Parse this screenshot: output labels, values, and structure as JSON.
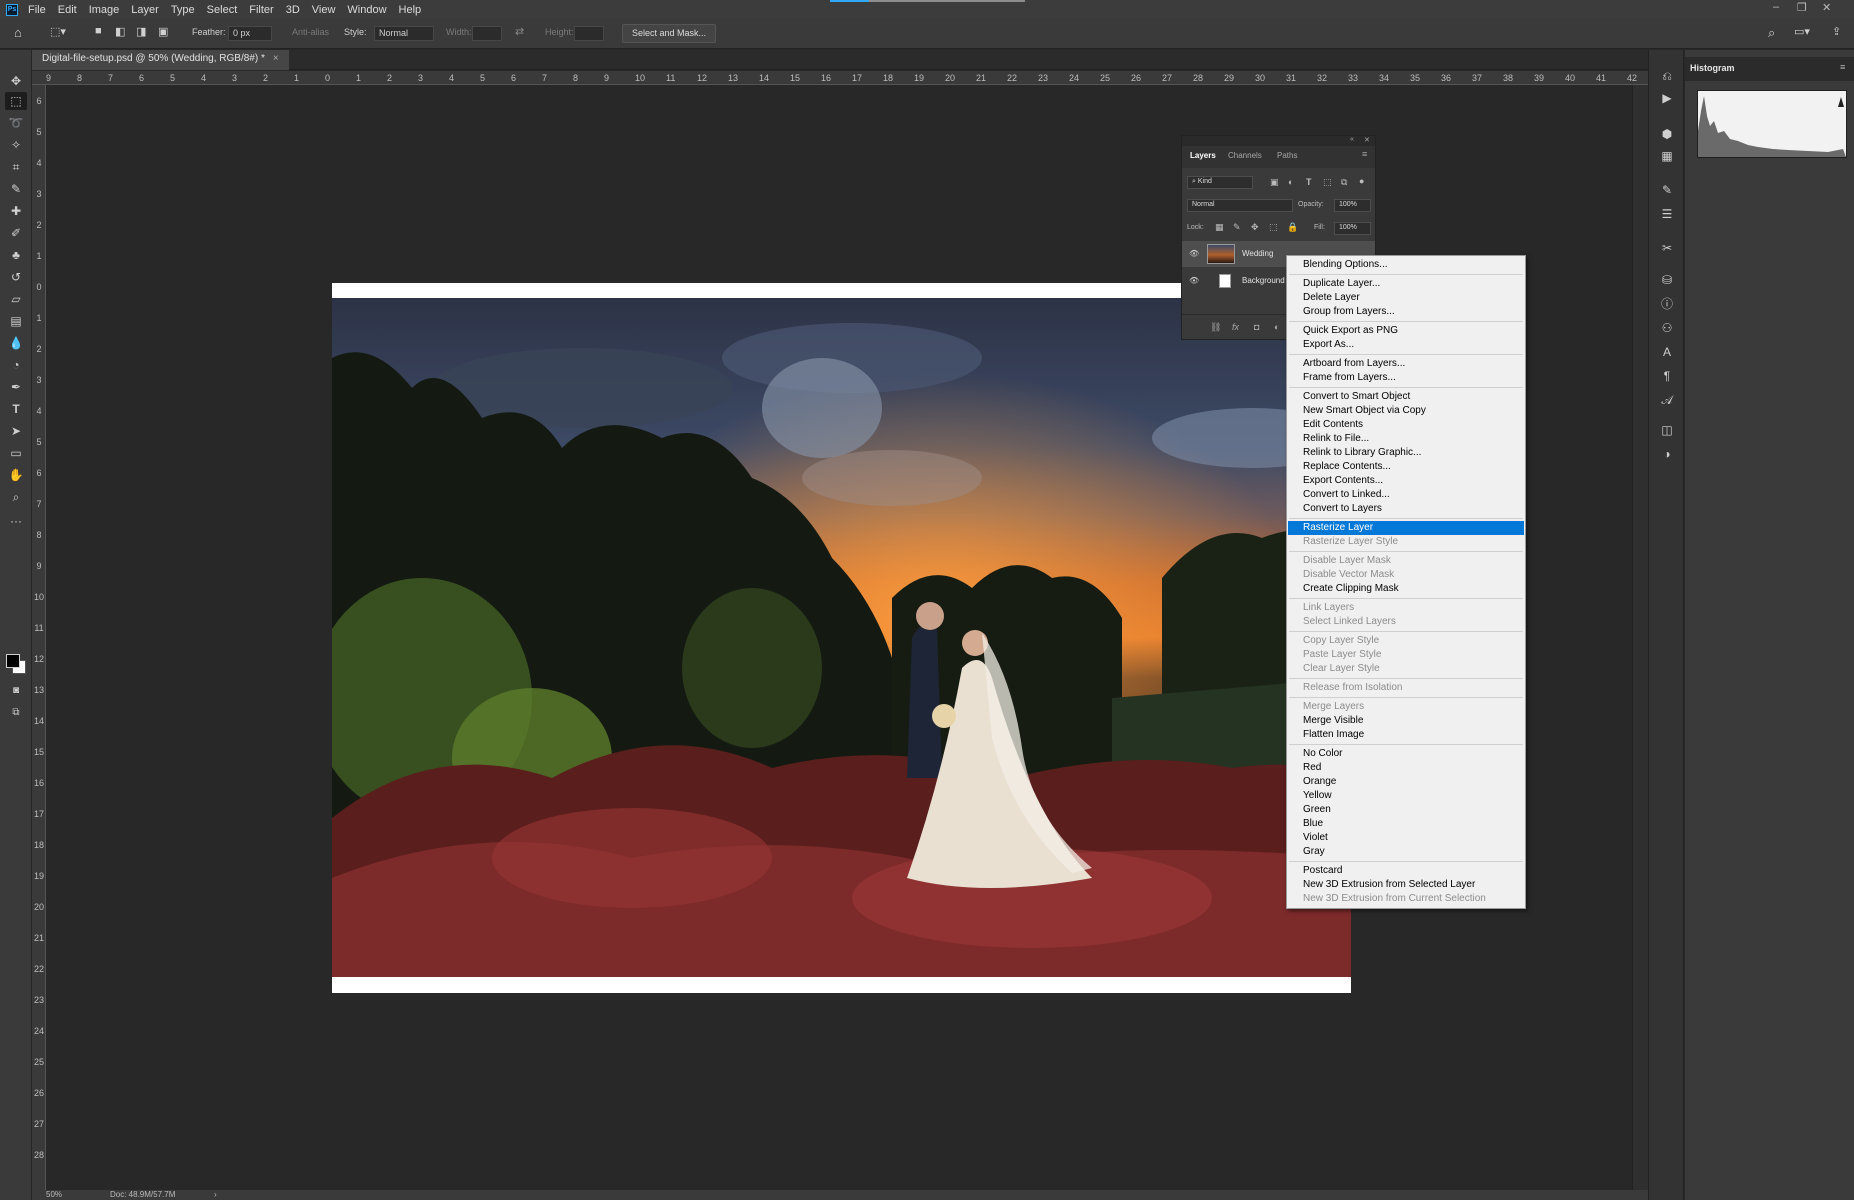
{
  "app": {
    "logo": "Ps"
  },
  "menubar": {
    "items": [
      "File",
      "Edit",
      "Image",
      "Layer",
      "Type",
      "Select",
      "Filter",
      "3D",
      "View",
      "Window",
      "Help"
    ],
    "window_controls": [
      "–",
      "❐",
      "✕"
    ]
  },
  "options_bar": {
    "feather_label": "Feather:",
    "feather_value": "0 px",
    "anti_alias_label": "Anti-alias",
    "style_label": "Style:",
    "style_value": "Normal",
    "width_label": "Width:",
    "height_label": "Height:",
    "select_mask_button": "Select and Mask..."
  },
  "document": {
    "tab_title": "Digital-file-setup.psd @ 50% (Wedding, RGB/8#) *",
    "close_glyph": "×"
  },
  "rulers": {
    "top_labels": [
      "9",
      "8",
      "7",
      "6",
      "5",
      "4",
      "3",
      "2",
      "1",
      "0",
      "1",
      "2",
      "3",
      "4",
      "5",
      "6",
      "7",
      "8",
      "9",
      "10",
      "11",
      "12",
      "13",
      "14",
      "15",
      "16",
      "17",
      "18",
      "19",
      "20",
      "21",
      "22",
      "23",
      "24",
      "25",
      "26",
      "27",
      "28",
      "29",
      "30",
      "31",
      "32",
      "33",
      "34",
      "35",
      "36",
      "37",
      "38",
      "39",
      "40",
      "41",
      "42"
    ],
    "left_labels": [
      "6",
      "5",
      "4",
      "3",
      "2",
      "1",
      "0",
      "1",
      "2",
      "3",
      "4",
      "5",
      "6",
      "7",
      "8",
      "9",
      "10",
      "11",
      "12",
      "13",
      "14",
      "15",
      "16",
      "17",
      "18",
      "19",
      "20",
      "21",
      "22",
      "23",
      "24",
      "25",
      "26",
      "27",
      "28"
    ]
  },
  "status_bar": {
    "zoom": "50%",
    "doc_size": "Doc: 48.9M/57.7M",
    "arrow": "›"
  },
  "histogram": {
    "title": "Histogram"
  },
  "layers_panel": {
    "tabs": [
      "Layers",
      "Channels",
      "Paths"
    ],
    "filter_kind": "Kind",
    "blend_mode": "Normal",
    "opacity_label": "Opacity:",
    "opacity_value": "100%",
    "lock_label": "Lock:",
    "fill_label": "Fill:",
    "fill_value": "100%",
    "layers": [
      {
        "name": "Wedding"
      },
      {
        "name": "Background"
      }
    ],
    "footer_icons": [
      "⛓",
      "fx",
      "◘",
      "◐"
    ]
  },
  "context_menu": {
    "items": [
      {
        "label": "Blending Options...",
        "state": "enabled"
      },
      {
        "label": "Duplicate Layer...",
        "state": "enabled"
      },
      {
        "label": "Delete Layer",
        "state": "enabled"
      },
      {
        "label": "Group from Layers...",
        "state": "enabled"
      },
      {
        "label": "Quick Export as PNG",
        "state": "enabled"
      },
      {
        "label": "Export As...",
        "state": "enabled"
      },
      {
        "label": "Artboard from Layers...",
        "state": "enabled"
      },
      {
        "label": "Frame from Layers...",
        "state": "enabled"
      },
      {
        "label": "Convert to Smart Object",
        "state": "enabled"
      },
      {
        "label": "New Smart Object via Copy",
        "state": "enabled"
      },
      {
        "label": "Edit Contents",
        "state": "enabled"
      },
      {
        "label": "Relink to File...",
        "state": "enabled"
      },
      {
        "label": "Relink to Library Graphic...",
        "state": "enabled"
      },
      {
        "label": "Replace Contents...",
        "state": "enabled"
      },
      {
        "label": "Export Contents...",
        "state": "enabled"
      },
      {
        "label": "Convert to Linked...",
        "state": "enabled"
      },
      {
        "label": "Convert to Layers",
        "state": "enabled"
      },
      {
        "label": "Rasterize Layer",
        "state": "highlighted"
      },
      {
        "label": "Rasterize Layer Style",
        "state": "disabled"
      },
      {
        "label": "Disable Layer Mask",
        "state": "disabled"
      },
      {
        "label": "Disable Vector Mask",
        "state": "disabled"
      },
      {
        "label": "Create Clipping Mask",
        "state": "enabled"
      },
      {
        "label": "Link Layers",
        "state": "disabled"
      },
      {
        "label": "Select Linked Layers",
        "state": "disabled"
      },
      {
        "label": "Copy Layer Style",
        "state": "disabled"
      },
      {
        "label": "Paste Layer Style",
        "state": "disabled"
      },
      {
        "label": "Clear Layer Style",
        "state": "disabled"
      },
      {
        "label": "Release from Isolation",
        "state": "disabled"
      },
      {
        "label": "Merge Layers",
        "state": "disabled"
      },
      {
        "label": "Merge Visible",
        "state": "enabled"
      },
      {
        "label": "Flatten Image",
        "state": "enabled"
      },
      {
        "label": "No Color",
        "state": "enabled"
      },
      {
        "label": "Red",
        "state": "enabled"
      },
      {
        "label": "Orange",
        "state": "enabled"
      },
      {
        "label": "Yellow",
        "state": "enabled"
      },
      {
        "label": "Green",
        "state": "enabled"
      },
      {
        "label": "Blue",
        "state": "enabled"
      },
      {
        "label": "Violet",
        "state": "enabled"
      },
      {
        "label": "Gray",
        "state": "enabled"
      },
      {
        "label": "Postcard",
        "state": "enabled"
      },
      {
        "label": "New 3D Extrusion from Selected Layer",
        "state": "enabled"
      },
      {
        "label": "New 3D Extrusion from Current Selection",
        "state": "disabled"
      }
    ]
  },
  "colors": {
    "accent": "#31a8ff",
    "menu_highlight": "#0078d7",
    "foreground_swatch": "#000000",
    "background_swatch": "#ffffff"
  },
  "icons": {
    "toolbar": [
      "move-icon",
      "rectangular-marquee-icon",
      "lasso-icon",
      "magic-wand-icon",
      "crop-icon",
      "eyedropper-icon",
      "spot-healing-icon",
      "brush-icon",
      "clone-stamp-icon",
      "history-brush-icon",
      "eraser-icon",
      "gradient-icon",
      "blur-icon",
      "dodge-icon",
      "pen-icon",
      "type-icon",
      "path-selection-icon",
      "rectangle-icon",
      "hand-icon",
      "zoom-icon",
      "more-tools-icon"
    ],
    "dock": [
      "history-icon",
      "actions-icon",
      "3d-icon",
      "artboard-icon",
      "brushes-icon",
      "adjustments-icon",
      "tools-icon",
      "libraries-icon",
      "info-icon",
      "clone-source-icon",
      "character-icon",
      "paragraph-icon",
      "glyphs-icon",
      "properties-icon",
      "color-icon"
    ]
  }
}
